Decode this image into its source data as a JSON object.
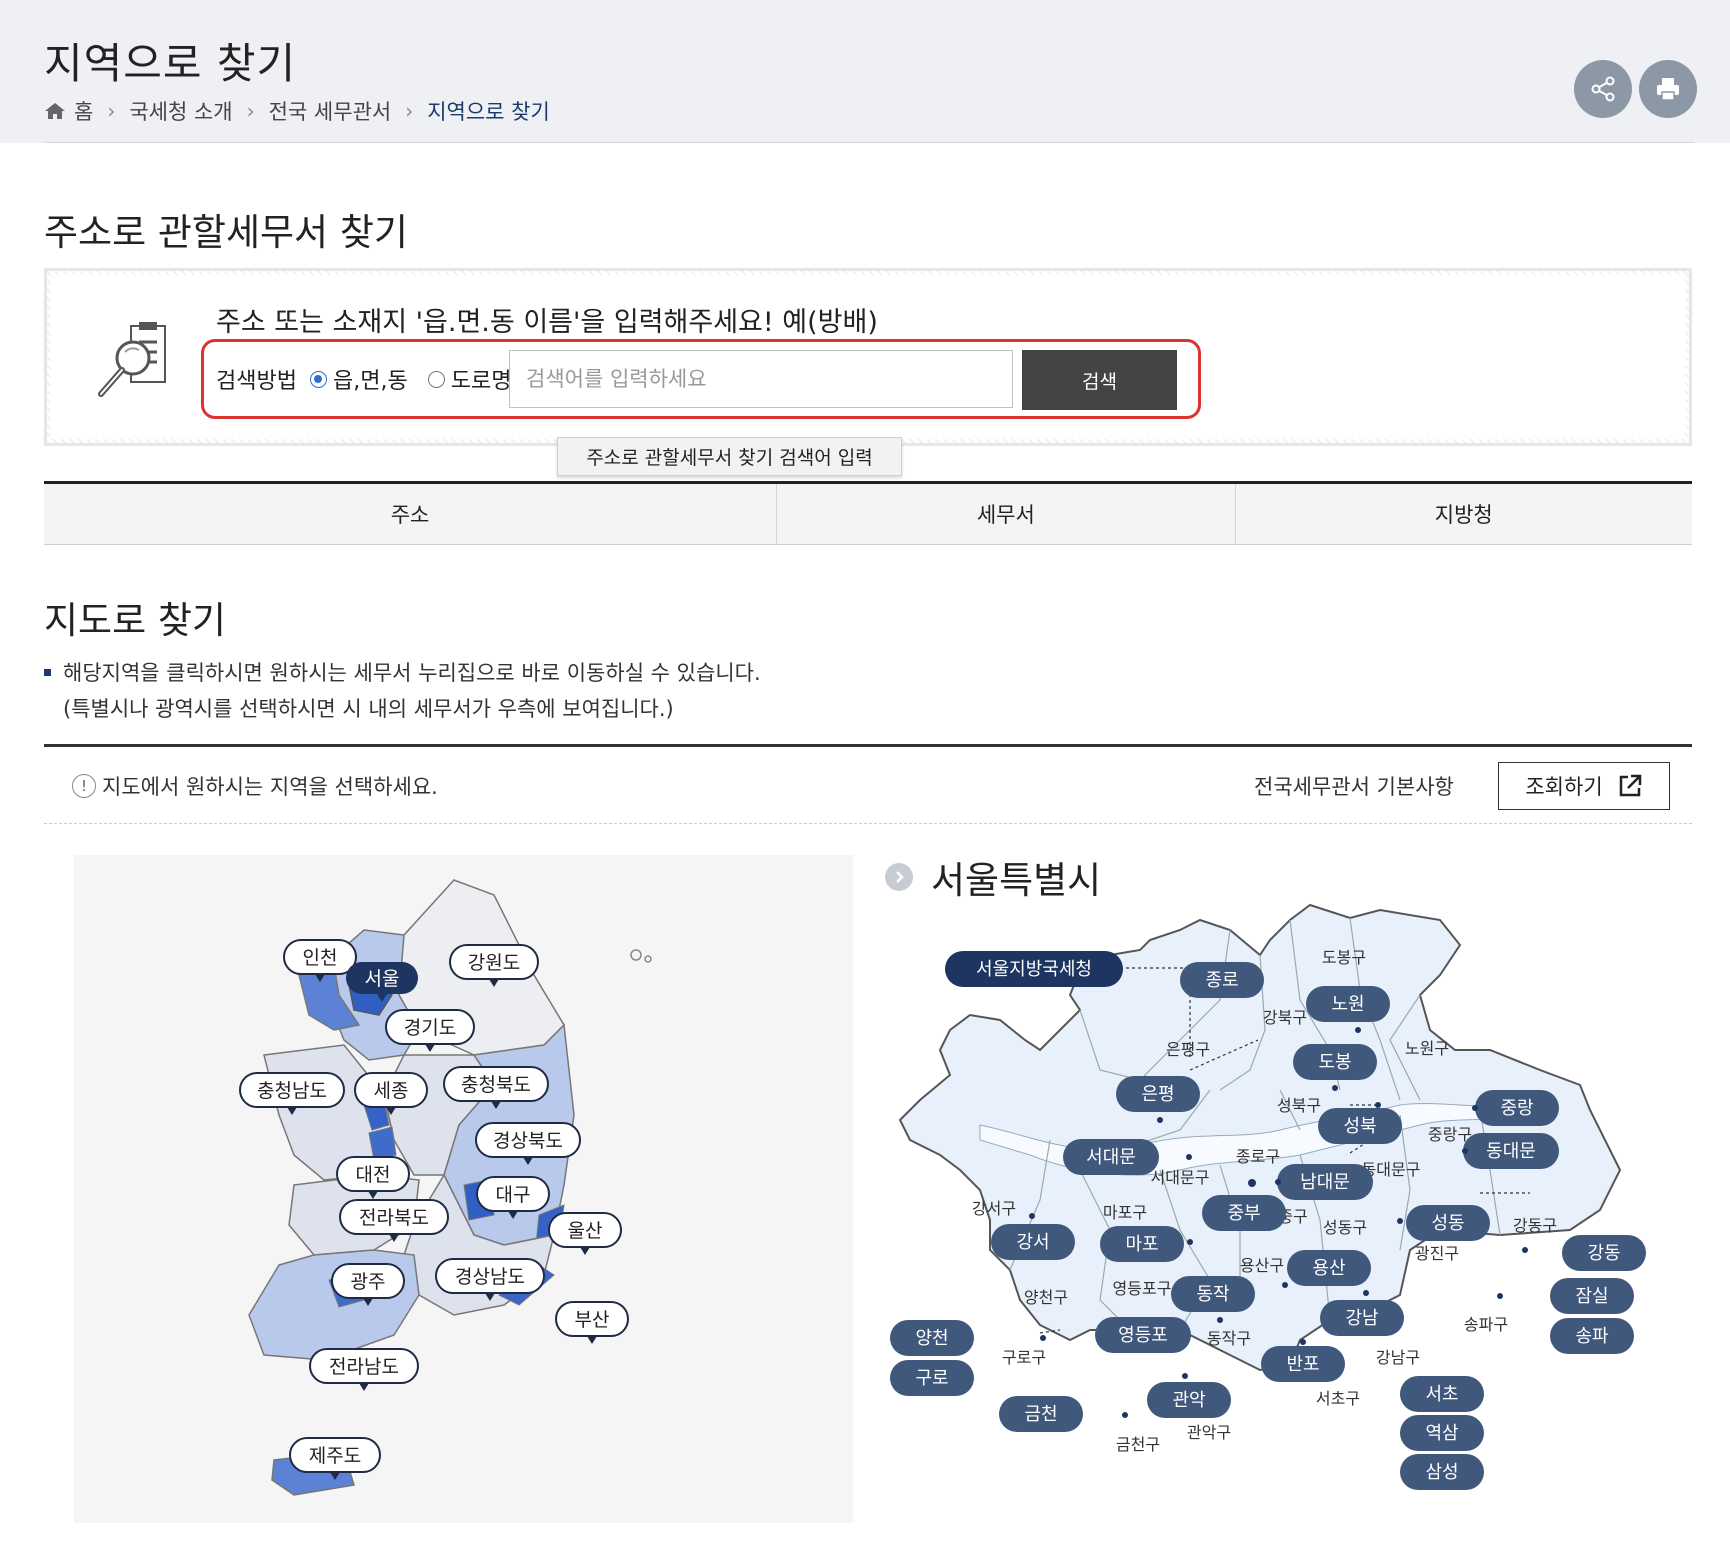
{
  "header": {
    "title": "지역으로 찾기",
    "breadcrumb": [
      "홈",
      "국세청 소개",
      "전국 세무관서",
      "지역으로 찾기"
    ]
  },
  "address_search": {
    "title": "주소로 관할세무서 찾기",
    "guide": "주소 또는 소재지 '읍.면.동 이름'을 입력해주세요! 예(방배)",
    "method_label": "검색방법",
    "options": [
      "읍,면,동",
      "도로명"
    ],
    "selected_option": "읍,면,동",
    "input_value": "",
    "placeholder": "검색어를 입력하세요",
    "button": "검색",
    "tooltip": "주소로 관할세무서 찾기  검색어 입력"
  },
  "result_tabs": [
    "주소",
    "세무서",
    "지방청"
  ],
  "map_search": {
    "title": "지도로 찾기",
    "desc_line1": "해당지역을 클릭하시면 원하시는 세무서 누리집으로 바로 이동하실 수 있습니다.",
    "desc_line2": "(특별시나 광역시를 선택하시면 시 내의 세무서가 우측에 보여집니다.)",
    "notice": "지도에서 원하시는 지역을 선택하세요.",
    "basics_label": "전국세무관서 기본사항",
    "view_button": "조회하기"
  },
  "korea_map": {
    "regions": [
      "인천",
      "서울",
      "강원도",
      "경기도",
      "충청남도",
      "세종",
      "충청북도",
      "경상북도",
      "대전",
      "대구",
      "전라북도",
      "울산",
      "광주",
      "경상남도",
      "부산",
      "전라남도",
      "제주도"
    ],
    "selected": "서울"
  },
  "seoul_map": {
    "title": "서울특별시",
    "regional_office": "서울지방국세청",
    "offices": [
      "종로",
      "노원",
      "도봉",
      "은평",
      "성북",
      "중랑",
      "동대문",
      "서대문",
      "남대문",
      "중부",
      "마포",
      "강서",
      "성동",
      "강동",
      "용산",
      "동작",
      "양천",
      "강남",
      "잠실",
      "영등포",
      "송파",
      "구로",
      "반포",
      "서초",
      "금천",
      "관악",
      "역삼",
      "삼성"
    ],
    "districts": [
      "도봉구",
      "강북구",
      "노원구",
      "은평구",
      "성북구",
      "중랑구",
      "종로구",
      "동대문구",
      "서대문구",
      "중구",
      "강서구",
      "마포구",
      "성동구",
      "강동구",
      "광진구",
      "용산구",
      "양천구",
      "영등포구",
      "송파구",
      "구로구",
      "동작구",
      "강남구",
      "서초구",
      "금천구",
      "관악구"
    ]
  }
}
